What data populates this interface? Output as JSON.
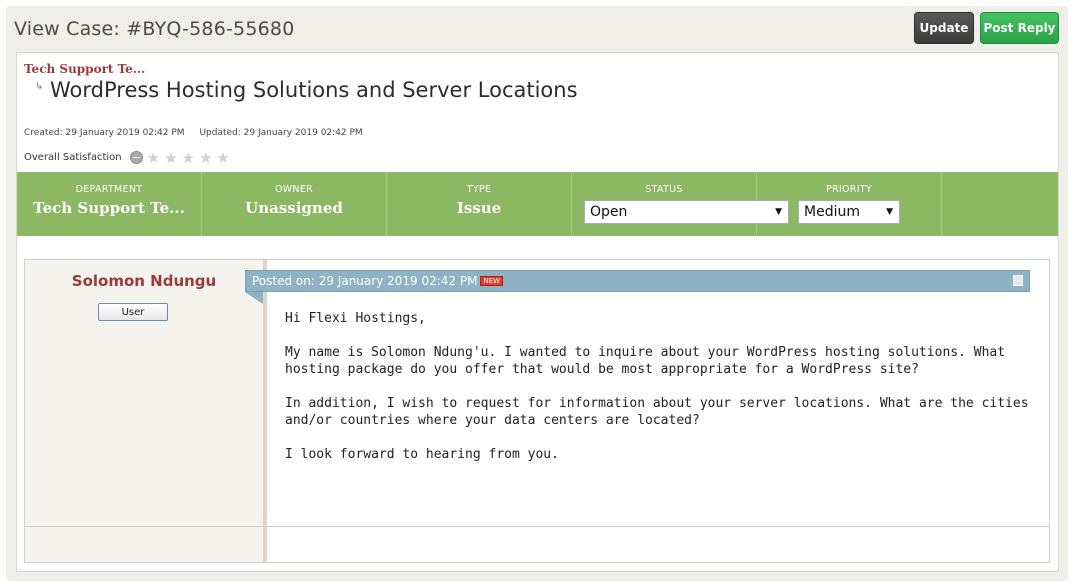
{
  "header": {
    "title": "View Case: #BYQ-586-55680",
    "update_label": "Update",
    "post_reply_label": "Post Reply"
  },
  "ticket": {
    "department_link": "Tech Support Te...",
    "subject": "WordPress Hosting Solutions and Server Locations",
    "created": "Created: 29 January 2019 02:42 PM",
    "updated": "Updated: 29 January 2019 02:42 PM",
    "satisfaction_label": "Overall Satisfaction",
    "satisfaction_stars": 0
  },
  "properties": {
    "department": {
      "label": "DEPARTMENT",
      "value": "Tech Support Te..."
    },
    "owner": {
      "label": "OWNER",
      "value": "Unassigned"
    },
    "type": {
      "label": "TYPE",
      "value": "Issue"
    },
    "status": {
      "label": "STATUS",
      "value": "Open"
    },
    "priority": {
      "label": "PRIORITY",
      "value": "Medium"
    }
  },
  "post": {
    "author": "Solomon Ndungu",
    "role": "User",
    "posted_on": "Posted on: 29 January 2019 02:42 PM",
    "new_badge": "NEW",
    "paragraphs": [
      "Hi Flexi Hostings,",
      "My name is Solomon Ndung'u. I wanted to inquire about your WordPress hosting solutions. What hosting package do you offer that would be most appropriate for a WordPress site?",
      "In addition, I wish to request for information about your server locations. What are the cities and/or countries where your data centers are located?",
      "I look forward to hearing from you."
    ]
  },
  "colors": {
    "green_bar": "#8cb864",
    "accent_red": "#9a3b3b",
    "posted_bar": "#8fb3c5",
    "reply_button": "#2aa248"
  }
}
